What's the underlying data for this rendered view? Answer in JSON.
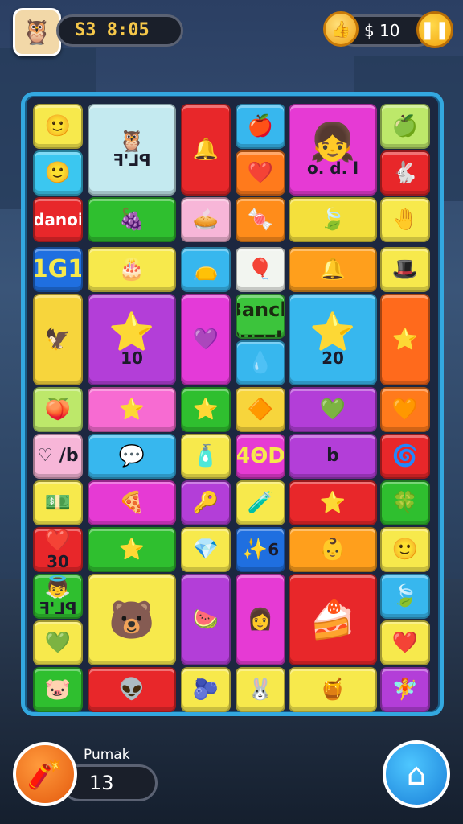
{
  "hud": {
    "score": "S3 8:05",
    "coins": "$  10",
    "pause_icon": "pause-icon"
  },
  "tiles": [
    {
      "name": "tile-face-yellow",
      "icon": "🙂",
      "text": "",
      "color": "#f7e94c"
    },
    {
      "name": "tile-owl-emblem",
      "icon": "🦉",
      "text": "ꟻꞌ⅃ꟼ",
      "color": "#c4eaf0"
    },
    {
      "name": "tile-bell-red",
      "icon": "🔔",
      "text": "",
      "color": "#e8272a"
    },
    {
      "name": "tile-apple-blue",
      "icon": "🍎",
      "text": "",
      "color": "#37b7ee"
    },
    {
      "name": "tile-girl-magenta",
      "icon": "👧",
      "text": "o. d. l",
      "color": "#e63ad4"
    },
    {
      "name": "tile-apple-green",
      "icon": "🍏",
      "text": "",
      "color": "#bde86a"
    },
    {
      "name": "tile-face-blue",
      "icon": "🙂",
      "text": "",
      "color": "#3bc7f0"
    },
    {
      "name": "tile-heart-orange",
      "icon": "❤️",
      "text": "",
      "color": "#ff7a1c"
    },
    {
      "name": "tile-rabbit-red",
      "icon": "🐇",
      "text": "",
      "color": "#e8272a"
    },
    {
      "name": "tile-word-banner",
      "icon": "",
      "text": "Iidanoia",
      "color": "#e8272a"
    },
    {
      "name": "tile-plum-green",
      "icon": "🍇",
      "text": "",
      "color": "#2fbf2f"
    },
    {
      "name": "tile-pie-pink",
      "icon": "🥧",
      "text": "",
      "color": "#f7b6d8"
    },
    {
      "name": "tile-candy-orange",
      "icon": "🍬",
      "text": "",
      "color": "#ff8c1a"
    },
    {
      "name": "tile-leaf-yellow",
      "icon": "🍃",
      "text": "",
      "color": "#f4e03c"
    },
    {
      "name": "tile-hand-yellow",
      "icon": "🤚",
      "text": "",
      "color": "#f7e94c"
    },
    {
      "name": "tile-number-blue",
      "icon": "",
      "text": "1G1",
      "color": "#1f6fe0"
    },
    {
      "name": "tile-cake-yellow",
      "icon": "🎂",
      "text": "",
      "color": "#f7e94c"
    },
    {
      "name": "tile-bag-blue",
      "icon": "👝",
      "text": "",
      "color": "#37b7ee"
    },
    {
      "name": "tile-balloon-white",
      "icon": "🎈",
      "text": "",
      "color": "#f2f5f0"
    },
    {
      "name": "tile-bell-orange",
      "icon": "🔔",
      "text": "",
      "color": "#ff9f1c"
    },
    {
      "name": "tile-hat-yellow",
      "icon": "🎩",
      "text": "",
      "color": "#f7e94c"
    },
    {
      "name": "tile-eagle-yellow",
      "icon": "🦅",
      "text": "",
      "color": "#f7d53c"
    },
    {
      "name": "tile-ten-purple",
      "icon": "⭐",
      "text": "10",
      "color": "#b33ed8"
    },
    {
      "name": "tile-heart-purple",
      "icon": "💜",
      "text": "",
      "color": "#e43ad8"
    },
    {
      "name": "tile-title-green",
      "icon": "",
      "text": "Banch\nPuzzla",
      "color": "#3cc43c"
    },
    {
      "name": "tile-twenty-blue",
      "icon": "⭐",
      "text": "20",
      "color": "#37b7ee"
    },
    {
      "name": "tile-star-red",
      "icon": "⭐",
      "text": "",
      "color": "#ff6a1c"
    },
    {
      "name": "tile-drop-blue",
      "icon": "💧",
      "text": "",
      "color": "#37b7ee"
    },
    {
      "name": "tile-peach-green",
      "icon": "🍑",
      "text": "",
      "color": "#bde86a"
    },
    {
      "name": "tile-star-pink",
      "icon": "⭐",
      "text": "",
      "color": "#f76bd2"
    },
    {
      "name": "tile-star-green",
      "icon": "⭐",
      "text": "",
      "color": "#2fbf2f"
    },
    {
      "name": "tile-shapes-yellow",
      "icon": "🔶",
      "text": "",
      "color": "#f7d53c"
    },
    {
      "name": "tile-heart-purple2",
      "icon": "💚",
      "text": "",
      "color": "#b33ed8"
    },
    {
      "name": "tile-heart-orange2",
      "icon": "🧡",
      "text": "",
      "color": "#ff7a1c"
    },
    {
      "name": "tile-letters-pink",
      "icon": "",
      "text": "♡ /b",
      "color": "#f7b6d8"
    },
    {
      "name": "tile-chat-blue",
      "icon": "💬",
      "text": "",
      "color": "#37b7ee"
    },
    {
      "name": "tile-bottle-yellow",
      "icon": "🧴",
      "text": "",
      "color": "#f7e94c"
    },
    {
      "name": "tile-code-magenta",
      "icon": "",
      "text": "4ΘD",
      "color": "#e63ad4"
    },
    {
      "name": "tile-b-purple",
      "icon": "",
      "text": "b",
      "color": "#b33ed8"
    },
    {
      "name": "tile-swirl-red",
      "icon": "🌀",
      "text": "",
      "color": "#e8272a"
    },
    {
      "name": "tile-money-yellow",
      "icon": "💵",
      "text": "",
      "color": "#f7e94c"
    },
    {
      "name": "tile-pizza-pink",
      "icon": "🍕",
      "text": "",
      "color": "#e63ad4"
    },
    {
      "name": "tile-key-purple",
      "icon": "🔑",
      "text": "",
      "color": "#b33ed8"
    },
    {
      "name": "tile-mix-yellow",
      "icon": "🧪",
      "text": "",
      "color": "#f7e94c"
    },
    {
      "name": "tile-star-red2",
      "icon": "⭐",
      "text": "",
      "color": "#e8272a"
    },
    {
      "name": "tile-blob-green",
      "icon": "🍀",
      "text": "",
      "color": "#2fbf2f"
    },
    {
      "name": "tile-heart-thirty",
      "icon": "❤️",
      "text": "30",
      "color": "#e8272a"
    },
    {
      "name": "tile-star-green2",
      "icon": "⭐",
      "text": "",
      "color": "#2fbf2f"
    },
    {
      "name": "tile-gem-yellow",
      "icon": "💎",
      "text": "",
      "color": "#f7e94c"
    },
    {
      "name": "tile-sparkle-blue",
      "icon": "✨",
      "text": "6",
      "color": "#1f6fe0"
    },
    {
      "name": "tile-baby-orange",
      "icon": "👶",
      "text": "",
      "color": "#ff9f1c"
    },
    {
      "name": "tile-face-yellow2",
      "icon": "🙂",
      "text": "",
      "color": "#f7e94c"
    },
    {
      "name": "tile-angel-green",
      "icon": "👼",
      "text": "ꟻꞌ⅃ꟼ",
      "color": "#2fbf2f"
    },
    {
      "name": "tile-bear-yellow",
      "icon": "🐻",
      "text": "",
      "color": "#f7e94c"
    },
    {
      "name": "tile-melon-purple",
      "icon": "🍉",
      "text": "",
      "color": "#b33ed8"
    },
    {
      "name": "tile-face-magenta",
      "icon": "👩",
      "text": "",
      "color": "#e63ad4"
    },
    {
      "name": "tile-cake-red",
      "icon": "🍰",
      "text": "",
      "color": "#e8272a"
    },
    {
      "name": "tile-leaf-blue",
      "icon": "🍃",
      "text": "",
      "color": "#37b7ee"
    },
    {
      "name": "tile-heart-yellow",
      "icon": "💚",
      "text": "",
      "color": "#f7e94c"
    },
    {
      "name": "tile-heart-yellow2",
      "icon": "❤️",
      "text": "",
      "color": "#f7e94c"
    },
    {
      "name": "tile-pig-green",
      "icon": "🐷",
      "text": "",
      "color": "#2fbf2f"
    },
    {
      "name": "tile-alien-red",
      "icon": "👽",
      "text": "",
      "color": "#e8272a"
    },
    {
      "name": "tile-berry-yellow",
      "icon": "🫐",
      "text": "",
      "color": "#f7e94c"
    },
    {
      "name": "tile-bunny-yellow",
      "icon": "🐰",
      "text": "",
      "color": "#f7e94c"
    },
    {
      "name": "tile-pot-yellow",
      "icon": "🍯",
      "text": "",
      "color": "#f7e94c"
    },
    {
      "name": "tile-fairy-purple",
      "icon": "🧚",
      "text": "",
      "color": "#b33ed8"
    },
    {
      "name": "tile-shield-orange",
      "icon": "🛡",
      "text": "",
      "color": "#ff9f1c"
    }
  ],
  "footer": {
    "moves_label": "Pumak",
    "moves_value": "13",
    "bomb_icon": "bomb-icon",
    "home_icon": "home-icon"
  }
}
